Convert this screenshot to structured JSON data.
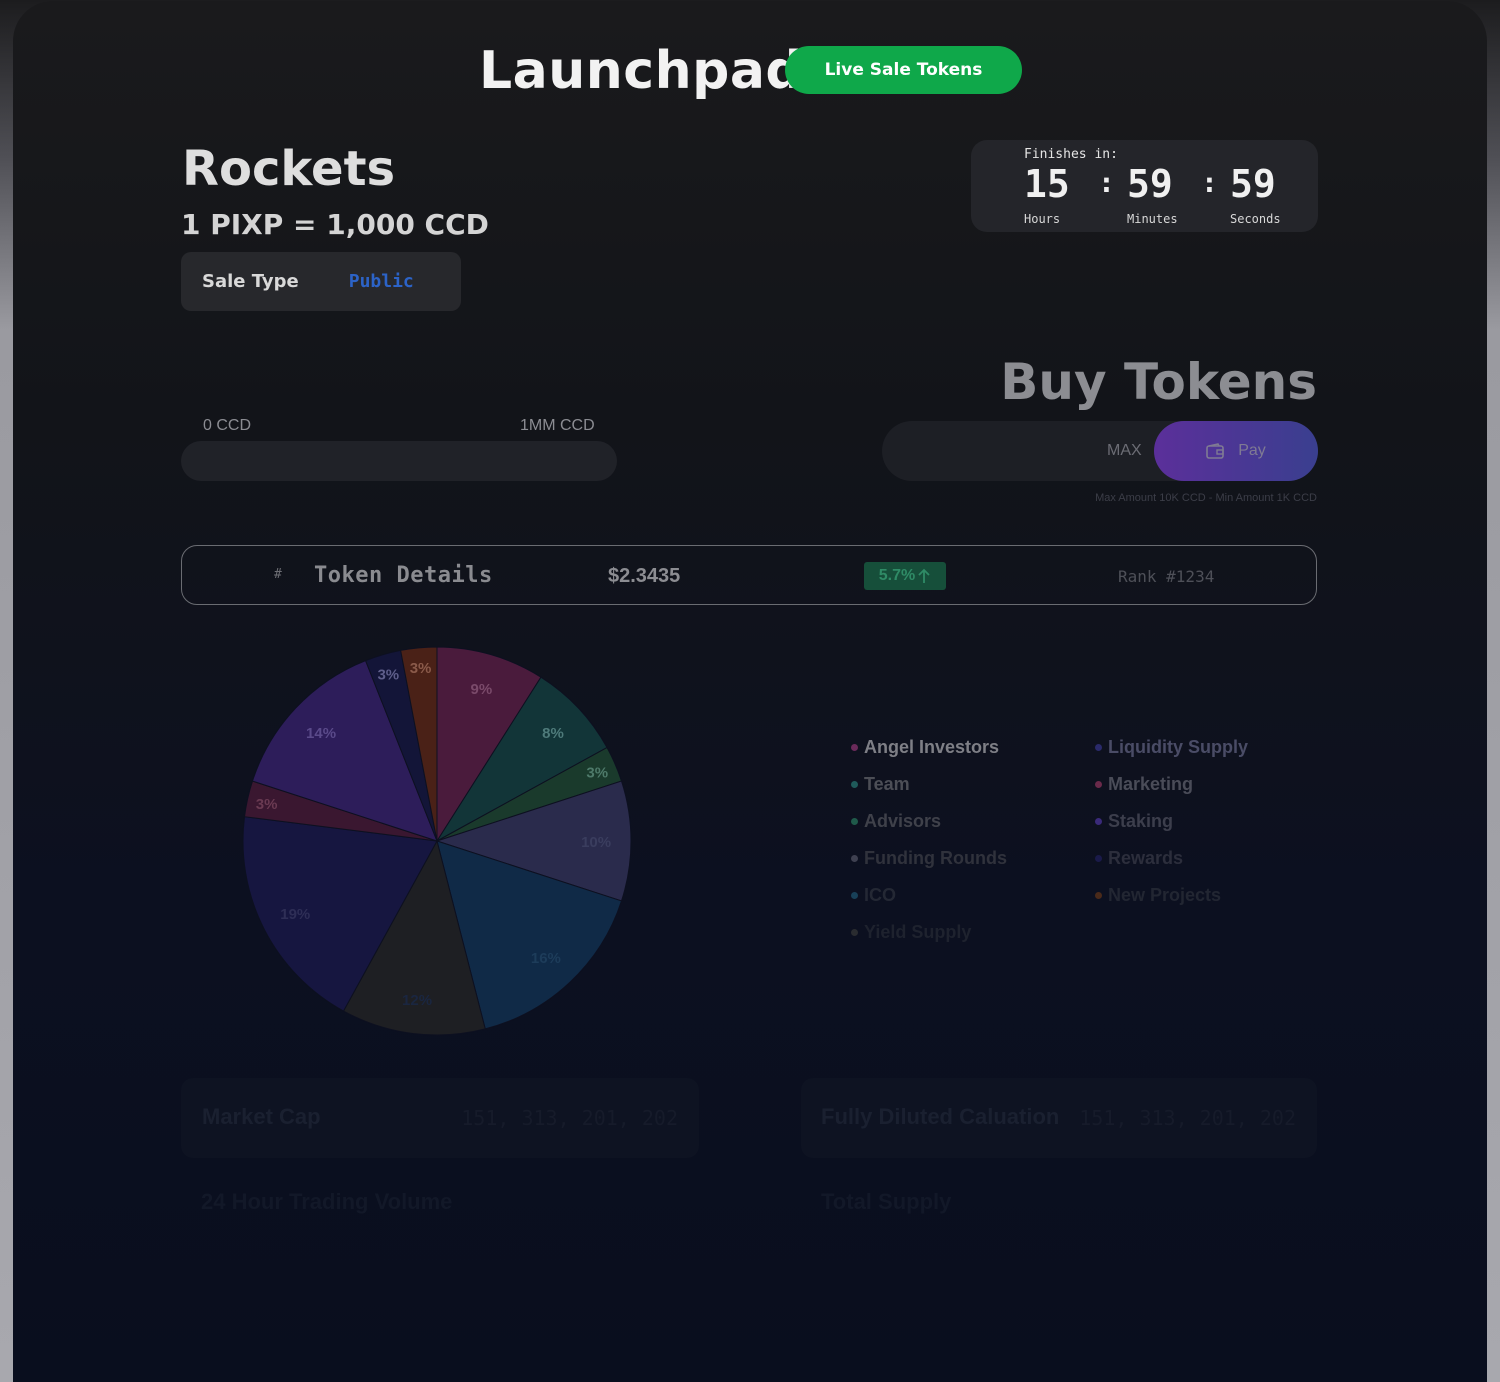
{
  "header": {
    "title": "Launchpad",
    "live_button": "Live Sale Tokens"
  },
  "project": {
    "name": "Rockets",
    "rate": "1 PIXP = 1,000 CCD",
    "sale_type_label": "Sale Type",
    "sale_type_value": "Public"
  },
  "countdown": {
    "caption": "Finishes in:",
    "hours": "15",
    "minutes": "59",
    "seconds": "59",
    "hours_label": "Hours",
    "minutes_label": "Minutes",
    "seconds_label": "Seconds",
    "separator": ":"
  },
  "progress": {
    "min_label": "0 CCD",
    "max_label": "1MM CCD",
    "fraction": 0
  },
  "buy": {
    "title": "Buy Tokens",
    "max_label": "MAX",
    "pay_label": "Pay",
    "limits": "Max Amount 10K CCD - Min Amount 1K CCD"
  },
  "token_details": {
    "hash": "#",
    "title": "Token Details",
    "price": "$2.3435",
    "change": "5.7%",
    "rank": "Rank #1234"
  },
  "chart_data": {
    "type": "pie",
    "slices": [
      {
        "label": "9%",
        "value": 9,
        "color": "#4a1b3c"
      },
      {
        "label": "8%",
        "value": 8,
        "color": "#123538"
      },
      {
        "label": "3%",
        "value": 3,
        "color": "#1a3a2c"
      },
      {
        "label": "10%",
        "value": 10,
        "color": "#2a2b4c"
      },
      {
        "label": "16%",
        "value": 16,
        "color": "#102a47"
      },
      {
        "label": "12%",
        "value": 12,
        "color": "#1e1f23"
      },
      {
        "label": "19%",
        "value": 19,
        "color": "#161640"
      },
      {
        "label": "3%",
        "value": 3,
        "color": "#3a1730"
      },
      {
        "label": "14%",
        "value": 14,
        "color": "#2d1d5a"
      },
      {
        "label": "3%",
        "value": 3,
        "color": "#131538"
      },
      {
        "label": "3%",
        "value": 3,
        "color": "#4a2117"
      }
    ],
    "label_colors": [
      "#7a4a6a",
      "#4e7a7a",
      "#4e7a6a",
      "#3a3d5e",
      "#1d3c5a",
      "#1a2640",
      "#2e2e56",
      "#6a3a52",
      "#5a4a8a",
      "#5e5e8a",
      "#8a5a4a"
    ]
  },
  "legend": {
    "left": [
      {
        "label": "Angel Investors",
        "dot": "#6a2a5a",
        "color": "#7e7f86"
      },
      {
        "label": "Team",
        "dot": "#1f5a5a",
        "color": "#4c4e56"
      },
      {
        "label": "Advisors",
        "dot": "#1f5a4a",
        "color": "#3f414a"
      },
      {
        "label": "Funding Rounds",
        "dot": "#3e4050",
        "color": "#30323c"
      },
      {
        "label": "ICO",
        "dot": "#184058",
        "color": "#242834"
      },
      {
        "label": "Yield Supply",
        "dot": "#2a2c30",
        "color": "#1e222e"
      }
    ],
    "right": [
      {
        "label": "Liquidity Supply",
        "dot": "#2a2a6a",
        "color": "#4a4c66"
      },
      {
        "label": "Marketing",
        "dot": "#6a2a4a",
        "color": "#4a4c58"
      },
      {
        "label": "Staking",
        "dot": "#3a2a7a",
        "color": "#3c3e4c"
      },
      {
        "label": "Rewards",
        "dot": "#1a1a4a",
        "color": "#2c2e3c"
      },
      {
        "label": "New Projects",
        "dot": "#4a2a1a",
        "color": "#222632"
      }
    ]
  },
  "stats": {
    "market_cap_label": "Market Cap",
    "market_cap_value": "151, 313, 201, 202",
    "fdv_label": "Fully Diluted Caluation",
    "fdv_value": "151, 313, 201, 202",
    "volume_label": "24 Hour Trading Volume",
    "total_label": "Total Supply"
  }
}
